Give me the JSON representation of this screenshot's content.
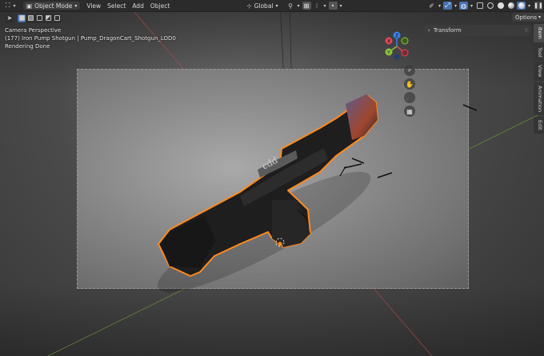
{
  "header": {
    "editor_icon": "editor-type-icon",
    "mode": "Object Mode",
    "menus": [
      "View",
      "Select",
      "Add",
      "Object"
    ],
    "orientation": "Global",
    "right_icons": [
      "visibility-icon",
      "gizmo-icon",
      "overlay-icon",
      "xray-icon",
      "wireframe-shading",
      "solid-shading",
      "material-shading",
      "rendered-shading"
    ]
  },
  "toolbar": {
    "tool_icon": "select-cursor-icon",
    "selection_modes": [
      "new-selection-icon",
      "extend-selection-icon",
      "subtract-selection-icon",
      "invert-selection-icon",
      "intersect-selection-icon"
    ]
  },
  "overlay_info": {
    "line1": "Camera Perspective",
    "line2": "(177) Iron Pump Shotgun | Pump_DragonCart_Shotgun_LOD0",
    "line3": "Rendering Done"
  },
  "gizmo": {
    "x": "X",
    "y": "Y",
    "z": "Z",
    "colors": {
      "x": "#e0465a",
      "y": "#8bc43f",
      "z": "#3a80e6"
    }
  },
  "sidebar": {
    "options_label": "Options",
    "panel_title": "Transform",
    "tabs": [
      "Item",
      "Tool",
      "View",
      "Animation",
      "Edit"
    ]
  },
  "accent_color": "#4772b3",
  "selection_outline_color": "#ff8a1f"
}
